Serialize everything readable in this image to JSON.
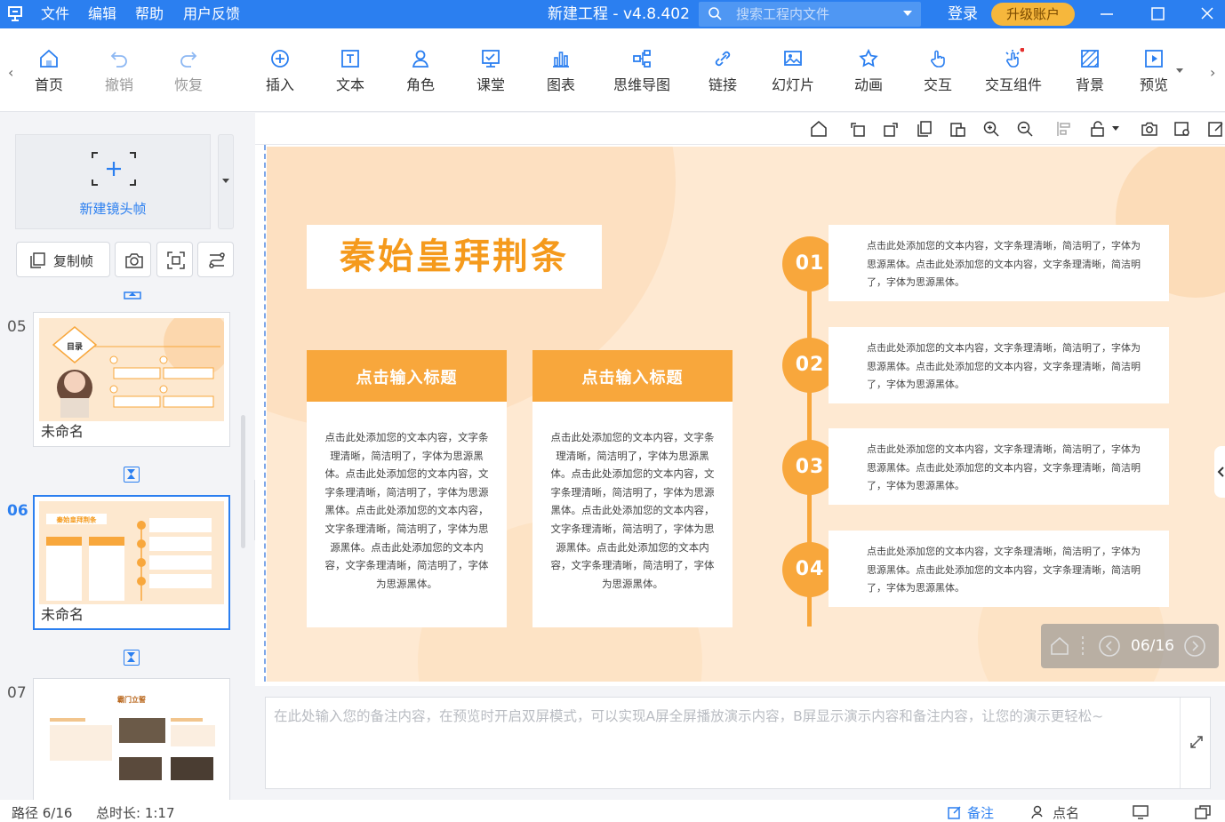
{
  "titlebar": {
    "menus": [
      "文件",
      "编辑",
      "帮助",
      "用户反馈"
    ],
    "app_title": "新建工程 - v4.8.402",
    "search_placeholder": "搜索工程内文件",
    "login": "登录",
    "upgrade": "升级账户"
  },
  "toolbar": {
    "items": [
      {
        "label": "首页",
        "icon": "home-icon"
      },
      {
        "label": "撤销",
        "icon": "undo-icon"
      },
      {
        "label": "恢复",
        "icon": "redo-icon"
      },
      {
        "label": "插入",
        "icon": "plus-circle-icon"
      },
      {
        "label": "文本",
        "icon": "text-icon"
      },
      {
        "label": "角色",
        "icon": "person-icon"
      },
      {
        "label": "课堂",
        "icon": "classroom-icon"
      },
      {
        "label": "图表",
        "icon": "chart-icon"
      },
      {
        "label": "思维导图",
        "icon": "mindmap-icon"
      },
      {
        "label": "链接",
        "icon": "link-icon"
      },
      {
        "label": "幻灯片",
        "icon": "slides-icon"
      },
      {
        "label": "动画",
        "icon": "star-icon"
      },
      {
        "label": "交互",
        "icon": "hand-icon"
      },
      {
        "label": "交互组件",
        "icon": "interaction-component-icon"
      },
      {
        "label": "背景",
        "icon": "background-icon"
      },
      {
        "label": "预览",
        "icon": "play-icon"
      }
    ]
  },
  "left_panel": {
    "new_frame_label": "新建镜头帧",
    "copy_frame_label": "复制帧",
    "thumbnails": [
      {
        "num": "05",
        "name": "未命名",
        "mini_title": "目录"
      },
      {
        "num": "06",
        "name": "未命名",
        "mini_title": "秦始皇拜荆条",
        "selected": true
      },
      {
        "num": "07",
        "name": "",
        "mini_title": "霸门立誓"
      }
    ]
  },
  "slide": {
    "title": "秦始皇拜荆条",
    "cards": [
      {
        "header": "点击输入标题",
        "body": "点击此处添加您的文本内容，文字条理清晰，简洁明了，字体为思源黑体。点击此处添加您的文本内容，文字条理清晰，简洁明了，字体为思源黑体。点击此处添加您的文本内容，文字条理清晰，简洁明了，字体为思源黑体。点击此处添加您的文本内容，文字条理清晰，简洁明了，字体为思源黑体。"
      },
      {
        "header": "点击输入标题",
        "body": "点击此处添加您的文本内容，文字条理清晰，简洁明了，字体为思源黑体。点击此处添加您的文本内容，文字条理清晰，简洁明了，字体为思源黑体。点击此处添加您的文本内容，文字条理清晰，简洁明了，字体为思源黑体。点击此处添加您的文本内容，文字条理清晰，简洁明了，字体为思源黑体。"
      }
    ],
    "timeline": [
      {
        "num": "01",
        "text": "点击此处添加您的文本内容，文字条理清晰，简洁明了，字体为思源黑体。点击此处添加您的文本内容，文字条理清晰，简洁明了，字体为思源黑体。"
      },
      {
        "num": "02",
        "text": "点击此处添加您的文本内容，文字条理清晰，简洁明了，字体为思源黑体。点击此处添加您的文本内容，文字条理清晰，简洁明了，字体为思源黑体。"
      },
      {
        "num": "03",
        "text": "点击此处添加您的文本内容，文字条理清晰，简洁明了，字体为思源黑体。点击此处添加您的文本内容，文字条理清晰，简洁明了，字体为思源黑体。"
      },
      {
        "num": "04",
        "text": "点击此处添加您的文本内容，文字条理清晰，简洁明了，字体为思源黑体。点击此处添加您的文本内容，文字条理清晰，简洁明了，字体为思源黑体。"
      }
    ],
    "pager": "06/16"
  },
  "notes": {
    "placeholder": "在此处输入您的备注内容，在预览时开启双屏模式，可以实现A屏全屏播放演示内容，B屏显示演示内容和备注内容，让您的演示更轻松~"
  },
  "statusbar": {
    "path": "路径 6/16",
    "duration": "总时长: 1:17",
    "notes_btn": "备注",
    "rollcall_btn": "点名"
  },
  "colors": {
    "brand_blue": "#2b7ff0",
    "slide_orange": "#f8a73c",
    "slide_bg": "#fee9d2",
    "upgrade_gold": "#f6b73c"
  }
}
